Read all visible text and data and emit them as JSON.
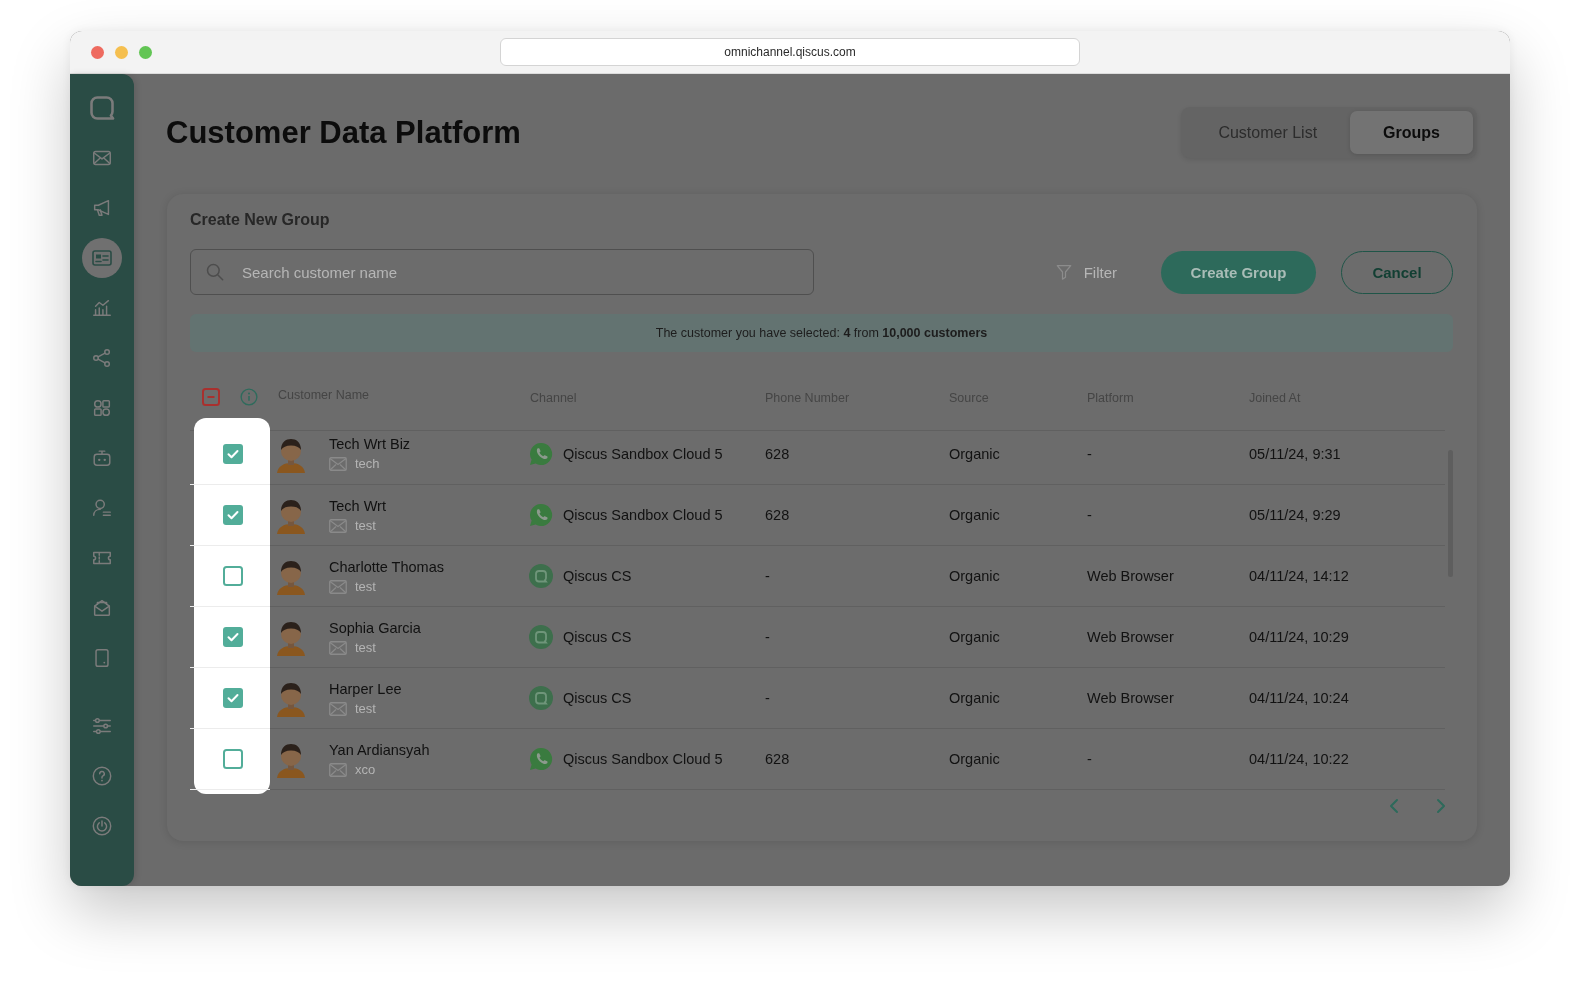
{
  "browser": {
    "url": "omnichannel.qiscus.com"
  },
  "sidebar": {
    "items": [
      {
        "kind": "chat",
        "selected": false
      },
      {
        "kind": "mail",
        "selected": false
      },
      {
        "kind": "megaphone",
        "selected": false
      },
      {
        "kind": "contacts",
        "selected": true
      },
      {
        "kind": "analytics",
        "selected": false
      },
      {
        "kind": "integration",
        "selected": false
      },
      {
        "kind": "apps",
        "selected": false
      },
      {
        "kind": "bot",
        "selected": false
      },
      {
        "kind": "agent",
        "selected": false
      },
      {
        "kind": "ticket",
        "selected": false
      },
      {
        "kind": "inbox",
        "selected": false
      },
      {
        "kind": "mobile",
        "selected": false
      }
    ],
    "bottom_items": [
      {
        "kind": "settings",
        "selected": false
      },
      {
        "kind": "help",
        "selected": false
      },
      {
        "kind": "power",
        "selected": false
      }
    ]
  },
  "header": {
    "title": "Customer Data Platform",
    "tabs": [
      {
        "label": "Customer List",
        "selected": false
      },
      {
        "label": "Groups",
        "selected": true
      }
    ]
  },
  "create_group": {
    "title": "Create New Group",
    "search": {
      "placeholder": "Search customer name"
    },
    "filter": {
      "label": "Filter"
    },
    "buttons": [
      {
        "label": "Create Group",
        "kind": "primary"
      },
      {
        "label": "Cancel",
        "kind": "outline"
      }
    ],
    "selection_note": "The customer you have selected: **4** from **10,000 customers**"
  },
  "table": {
    "select_all": {
      "indeterminate": true
    },
    "columns": [
      "Customer Name",
      "Channel",
      "Phone Number",
      "Source",
      "Platform",
      "Joined At"
    ],
    "rows": [
      {
        "checked": true,
        "name": "Tech Wrt Biz",
        "email": "tech",
        "channel": {
          "kind": "phone",
          "name": "Qiscus Sandbox Cloud 5"
        },
        "phone": "628",
        "source": "Organic",
        "platform": "-",
        "joined_at": "05/11/24, 9:31"
      },
      {
        "checked": true,
        "name": "Tech Wrt",
        "email": "test",
        "channel": {
          "kind": "phone",
          "name": "Qiscus Sandbox Cloud 5"
        },
        "phone": "628",
        "source": "Organic",
        "platform": "-",
        "joined_at": "05/11/24, 9:29"
      },
      {
        "checked": false,
        "name": "Charlotte Thomas",
        "email": "test",
        "channel": {
          "kind": "widget",
          "name": "Qiscus CS"
        },
        "phone": "-",
        "source": "Organic",
        "platform": "Web Browser",
        "joined_at": "04/11/24, 14:12"
      },
      {
        "checked": true,
        "name": "Sophia Garcia",
        "email": "test",
        "channel": {
          "kind": "widget",
          "name": "Qiscus CS"
        },
        "phone": "-",
        "source": "Organic",
        "platform": "Web Browser",
        "joined_at": "04/11/24, 10:29"
      },
      {
        "checked": true,
        "name": "Harper Lee",
        "email": "test",
        "channel": {
          "kind": "widget",
          "name": "Qiscus CS"
        },
        "phone": "-",
        "source": "Organic",
        "platform": "Web Browser",
        "joined_at": "04/11/24, 10:24"
      },
      {
        "checked": false,
        "name": "Yan Ardiansyah",
        "email": "xco",
        "channel": {
          "kind": "phone",
          "name": "Qiscus Sandbox Cloud 5"
        },
        "phone": "628",
        "source": "Organic",
        "platform": "-",
        "joined_at": "04/11/24, 10:22"
      }
    ]
  }
}
